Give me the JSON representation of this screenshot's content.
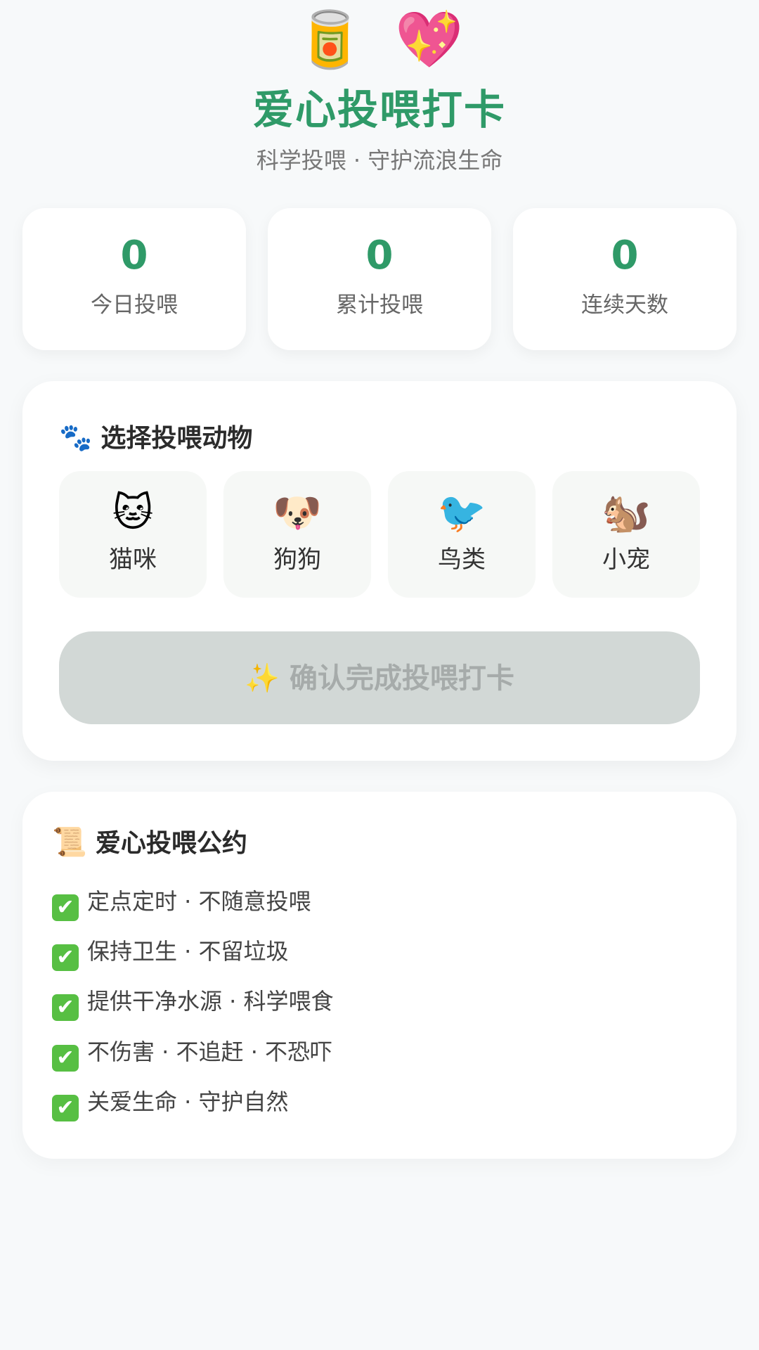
{
  "header": {
    "icons": [
      "🥫",
      "💖"
    ],
    "title": "爱心投喂打卡",
    "subtitle": "科学投喂 · 守护流浪生命"
  },
  "stats": [
    {
      "value": "0",
      "label": "今日投喂"
    },
    {
      "value": "0",
      "label": "累计投喂"
    },
    {
      "value": "0",
      "label": "连续天数"
    }
  ],
  "selection": {
    "icon": "🐾",
    "title": "选择投喂动物",
    "animals": [
      {
        "icon": "🐱",
        "label": "猫咪"
      },
      {
        "icon": "🐶",
        "label": "狗狗"
      },
      {
        "icon": "🐦",
        "label": "鸟类"
      },
      {
        "icon": "🐿️",
        "label": "小宠"
      }
    ],
    "confirm_icon": "✨",
    "confirm_label": "确认完成投喂打卡"
  },
  "rules": {
    "icon": "📜",
    "title": "爱心投喂公约",
    "check_icon": "✔",
    "items": [
      "定点定时 · 不随意投喂",
      "保持卫生 · 不留垃圾",
      "提供干净水源 · 科学喂食",
      "不伤害 · 不追赶 · 不恐吓",
      "关爱生命 · 守护自然"
    ]
  },
  "colors": {
    "accent": "#2f9a68",
    "disabled_button": "#d2d8d6",
    "check": "#57bf43",
    "background": "#f7f9fa"
  }
}
